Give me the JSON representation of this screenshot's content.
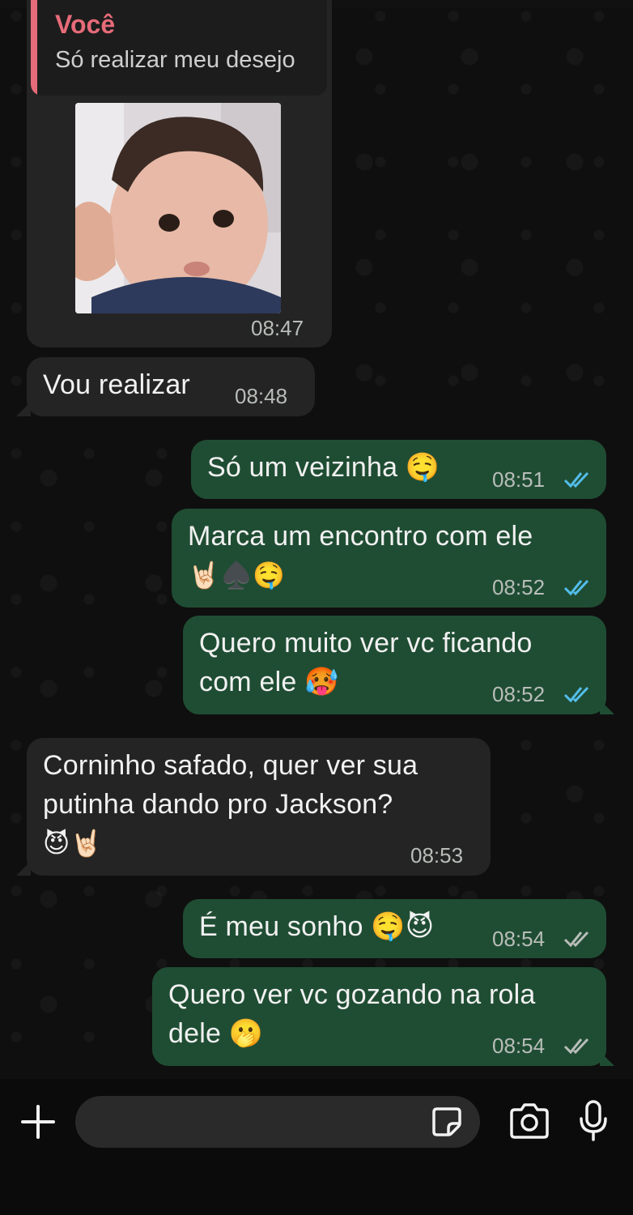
{
  "messages": [
    {
      "id": "m1",
      "direction": "incoming",
      "quote": {
        "author": "Você",
        "text": "Só realizar meu desejo"
      },
      "media": "photo",
      "time": "08:47"
    },
    {
      "id": "m2",
      "direction": "incoming",
      "text": "Vou realizar",
      "time": "08:48"
    },
    {
      "id": "m3",
      "direction": "outgoing",
      "text": "Só um veizinha 🤤",
      "time": "08:51",
      "status": "read"
    },
    {
      "id": "m4",
      "direction": "outgoing",
      "line1": "Marca um encontro com ele",
      "line2": "🤘🏻♠️🤤",
      "time": "08:52",
      "status": "read"
    },
    {
      "id": "m5",
      "direction": "outgoing",
      "line1": "Quero muito ver vc ficando",
      "line2": "com ele 🥵",
      "time": "08:52",
      "status": "read"
    },
    {
      "id": "m6",
      "direction": "incoming",
      "line1": "Corninho safado, quer ver sua",
      "line2": "putinha dando pro Jackson?",
      "line3": "😈🤘🏻",
      "time": "08:53"
    },
    {
      "id": "m7",
      "direction": "outgoing",
      "text": "É meu sonho 🤤😈",
      "time": "08:54",
      "status": "delivered"
    },
    {
      "id": "m8",
      "direction": "outgoing",
      "line1": "Quero ver vc gozando na rola",
      "line2": "dele 🫢",
      "time": "08:54",
      "status": "delivered"
    }
  ],
  "colors": {
    "outgoing_bubble": "#1f4d33",
    "incoming_bubble": "#242424",
    "read_ticks": "#53bdeb",
    "delivered_ticks": "#b8bdb9",
    "quote_accent": "#e66b79"
  },
  "input_bar": {
    "icons": [
      "plus-icon",
      "sticker-icon",
      "camera-icon",
      "microphone-icon"
    ]
  }
}
